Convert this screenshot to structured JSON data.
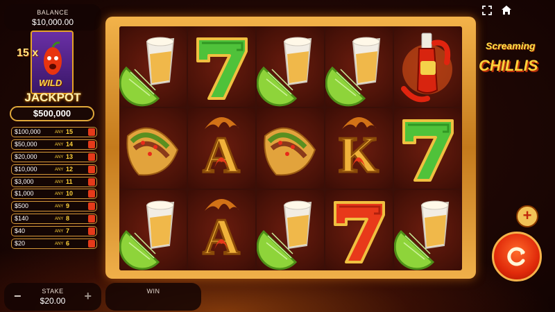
{
  "balance": {
    "label": "BALANCE",
    "value": "$10,000.00"
  },
  "jackpot": {
    "multiplier": "15 x",
    "wild_label": "WILD",
    "title": "JACKPOT",
    "amount": "$500,000",
    "prizes": [
      {
        "amount": "$100,000",
        "any": "ANY",
        "count": "15"
      },
      {
        "amount": "$50,000",
        "any": "ANY",
        "count": "14"
      },
      {
        "amount": "$20,000",
        "any": "ANY",
        "count": "13"
      },
      {
        "amount": "$10,000",
        "any": "ANY",
        "count": "12"
      },
      {
        "amount": "$3,000",
        "any": "ANY",
        "count": "11"
      },
      {
        "amount": "$1,000",
        "any": "ANY",
        "count": "10"
      },
      {
        "amount": "$500",
        "any": "ANY",
        "count": "9"
      },
      {
        "amount": "$140",
        "any": "ANY",
        "count": "8"
      },
      {
        "amount": "$40",
        "any": "ANY",
        "count": "7"
      },
      {
        "amount": "$20",
        "any": "ANY",
        "count": "6"
      }
    ]
  },
  "logo": {
    "line1": "Screaming",
    "line2": "CHILLIS"
  },
  "stake": {
    "label": "STAKE",
    "value": "$20.00",
    "minus": "−",
    "plus": "+"
  },
  "win": {
    "label": "WIN",
    "value": ""
  },
  "controls": {
    "plus_symbol": "+",
    "fullscreen_icon": "fullscreen-icon",
    "home_icon": "home-icon",
    "spin_icon": "spin-icon"
  },
  "reels": [
    [
      "tequila-lime",
      "taco",
      "tequila-lime"
    ],
    [
      "green-seven",
      "gold-a",
      "gold-a"
    ],
    [
      "tequila-lime",
      "taco",
      "tequila-lime"
    ],
    [
      "tequila-lime",
      "gold-k",
      "red-seven"
    ],
    [
      "hot-sauce",
      "green-seven",
      "tequila-lime"
    ]
  ],
  "colors": {
    "frame": "#e8a23c",
    "accent": "#ffd23a",
    "spin": "#e02a0a",
    "background": "#1e0704"
  }
}
